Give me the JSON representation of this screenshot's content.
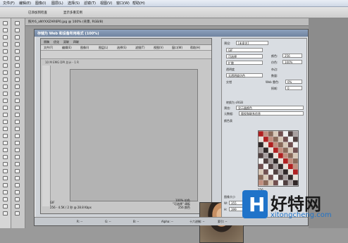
{
  "menu": [
    "文件(F)",
    "编辑(E)",
    "图像(I)",
    "图层(L)",
    "选择(S)",
    "滤镜(T)",
    "视图(V)",
    "窗口(W)",
    "帮助(H)"
  ],
  "options": {
    "checkbox_label": "已添加到检查",
    "refine_label": "显示多重实例"
  },
  "tab": {
    "title": "照片6_aNYXXZAR6P0.jpg @ 100% (背景, RGB/8)"
  },
  "dialog": {
    "title": "存储为 Web 和设备所用格式 (100%)",
    "tabs": [
      "原稿",
      "优化",
      "双联",
      "四联"
    ],
    "menu": [
      "文件(F)",
      "编辑(E)",
      "图像(I)",
      "图层(L)",
      "选择(S)",
      "滤镜(T)",
      "视图(V)",
      "窗口(W)",
      "帮助(H)"
    ],
    "zoom": "100%",
    "docinfo": "10 M  EMG DPI 总计 - 1 R",
    "status_left": "GIF",
    "status_left2": "256 - 4.5K / 2 秒 @ 28.8 Kbps",
    "status_right": "100% 仿色",
    "status_right2": "\"可选择\" 调板",
    "status_right3": "256 颜色",
    "bottom": [
      "R: --",
      "G: --",
      "B: --",
      "Alpha: --",
      "十六进制: --",
      "索引: --"
    ]
  },
  "panel": {
    "preset_label": "预设:",
    "preset_value": "[未命名]",
    "format": "GIF",
    "reduction": "可选择",
    "dither": "扩散",
    "colors_label": "颜色:",
    "colors_value": "256",
    "dither_label": "仿色:",
    "dither_value": "100%",
    "transparency": "透明度",
    "matte_label": "杂边:",
    "transparency_dither": "无透明度仿色",
    "amount_label": "数量:",
    "interlaced": "交错",
    "web_snap_label": "Web 靠色:",
    "web_snap_value": "0%",
    "lossy_label": "损耗:",
    "lossy_value": "0",
    "convert_label": "转换为 sRGB",
    "preview_label": "预览:",
    "preview_value": "显示器颜色",
    "metadata_label": "元数据:",
    "metadata_value": "版权和联系信息",
    "color_table_label": "颜色表",
    "image_size_label": "图像大小",
    "width_label": "W:",
    "width_value": "355",
    "height_label": "H:",
    "height_value": "399",
    "count": "256"
  },
  "watermark": {
    "brand": "好特网",
    "url": "xitongcheng.com",
    "logo_letter": "H"
  }
}
